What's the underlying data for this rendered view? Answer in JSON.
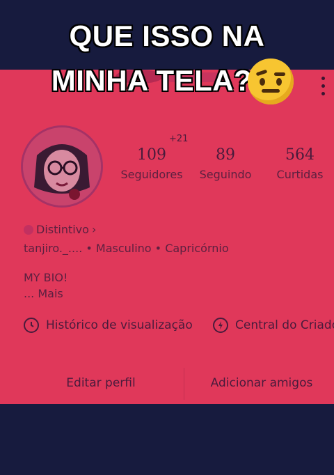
{
  "caption": {
    "line1": "QUE ISSO NA",
    "line2": "MINHA TELA?"
  },
  "profile": {
    "stats": [
      {
        "value": "109",
        "label": "Seguidores"
      },
      {
        "value": "89",
        "label": "Seguindo"
      },
      {
        "value": "564",
        "label": "Curtidas"
      }
    ],
    "followers_delta": "+21",
    "badge_label": "Distintivo",
    "badge_chevron": "›",
    "info_line": "tanjiro._.... • Masculino • Capricórnio",
    "bio_line1": "MY BIO!",
    "bio_line2": "...  Mais"
  },
  "links": {
    "history": "Histórico de visualização",
    "creator": "Central do Criador"
  },
  "buttons": {
    "edit": "Editar perfil",
    "add": "Adicionar amigos"
  },
  "colors": {
    "screen_tint": "#e0385a",
    "background": "#171b3e",
    "text": "#4a1b3c"
  },
  "icons": {
    "more": "vertical-dots-icon",
    "emoji": "raised-eyebrow-emoji"
  }
}
